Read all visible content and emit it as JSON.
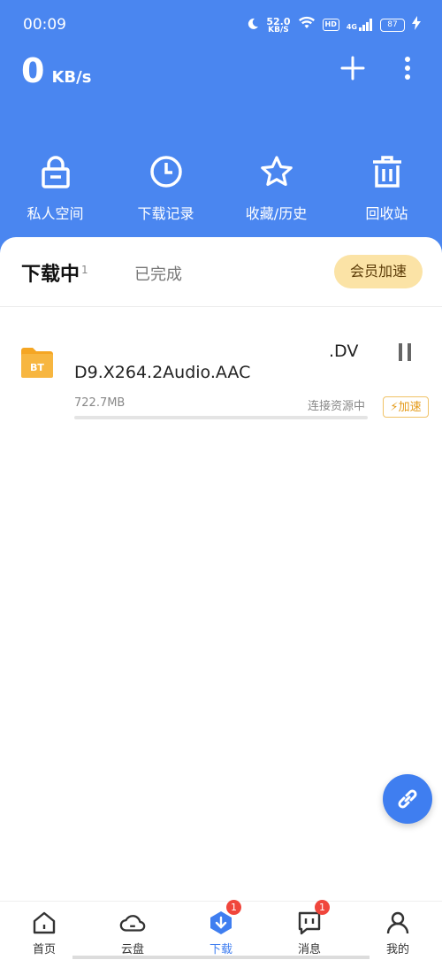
{
  "status_bar": {
    "time": "00:09",
    "net_speed_value": "52.0",
    "net_speed_unit": "KB/S",
    "hd_label": "HD",
    "network_label": "4G",
    "battery": "87"
  },
  "header": {
    "speed_number": "0",
    "speed_unit": "KB/s"
  },
  "quick_actions": [
    {
      "label": "私人空间",
      "icon": "lock-icon"
    },
    {
      "label": "下载记录",
      "icon": "clock-icon"
    },
    {
      "label": "收藏/历史",
      "icon": "star-icon"
    },
    {
      "label": "回收站",
      "icon": "trash-icon"
    }
  ],
  "tabs": {
    "downloading_label": "下载中",
    "downloading_count": "1",
    "completed_label": "已完成",
    "vip_button": "会员加速"
  },
  "task": {
    "name_line1": ".DV",
    "name_line2": "D9.X264.2Audio.AAC",
    "size": "722.7MB",
    "status": "连接资源中",
    "boost_label": "加速",
    "file_badge": "BT",
    "progress": 0
  },
  "bottom_nav": [
    {
      "label": "首页",
      "icon": "home-icon",
      "active": false
    },
    {
      "label": "云盘",
      "icon": "cloud-icon",
      "active": false
    },
    {
      "label": "下载",
      "icon": "download-icon",
      "active": true,
      "badge": "1"
    },
    {
      "label": "消息",
      "icon": "message-icon",
      "active": false,
      "badge": "1"
    },
    {
      "label": "我的",
      "icon": "profile-icon",
      "active": false
    }
  ],
  "colors": {
    "header_blue": "#4a86f0",
    "accent_blue": "#3f7ef0",
    "vip_gold": "#fbe3a6",
    "badge_red": "#f0463c"
  }
}
